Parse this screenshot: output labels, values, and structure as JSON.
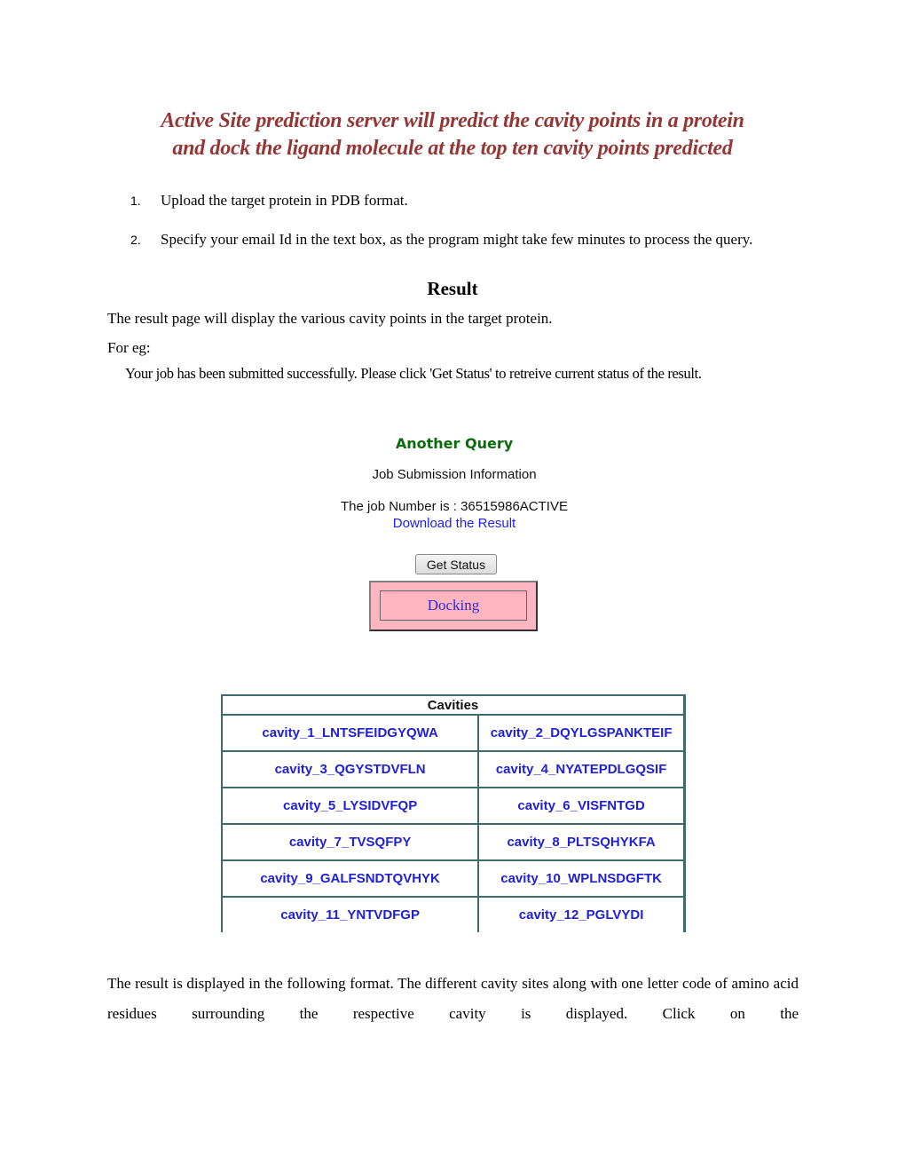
{
  "title": {
    "line1": "Active Site prediction server will predict the cavity points in a protein",
    "line2": "and dock the ligand molecule at the top ten cavity points predicted"
  },
  "instructions": [
    {
      "number": "1.",
      "text": "Upload the target protein in PDB format."
    },
    {
      "number": "2.",
      "text": "Specify your email Id in the text box, as the program might take few minutes to process the query."
    }
  ],
  "result_section": {
    "heading": "Result",
    "description": "The result page will display the various cavity points in the target protein.",
    "example_label": "For eg:",
    "submission_message": "Your job has been submitted successfully. Please click 'Get Status' to retreive current status of the result."
  },
  "job_panel": {
    "another_query": "Another Query",
    "info_heading": "Job Submission Information",
    "job_number_text": "The job Number is : 36515986ACTIVE",
    "download_link": "Download the Result",
    "get_status_button": "Get Status",
    "status": "Docking",
    "colors": {
      "another_query": "#0a6b0a",
      "link": "#2020e8",
      "status_bg": "#ffb6c1"
    }
  },
  "cavities_table": {
    "header": "Cavities",
    "rows": [
      [
        "cavity_1_LNTSFEIDGYQWA",
        "cavity_2_DQYLGSPANKTEIF"
      ],
      [
        "cavity_3_QGYSTDVFLN",
        "cavity_4_NYATEPDLGQSIF"
      ],
      [
        "cavity_5_LYSIDVFQP",
        "cavity_6_VISFNTGD"
      ],
      [
        "cavity_7_TVSQFPY",
        "cavity_8_PLTSQHYKFA"
      ],
      [
        "cavity_9_GALFSNDTQVHYK",
        "cavity_10_WPLNSDGFTK"
      ],
      [
        "cavity_11_YNTVDFGP",
        "cavity_12_PGLVYDI"
      ]
    ]
  },
  "bottom_paragraph": "The result is displayed in the following format. The different cavity sites along with one letter code of amino acid residues surrounding the respective cavity is displayed. Click on the"
}
